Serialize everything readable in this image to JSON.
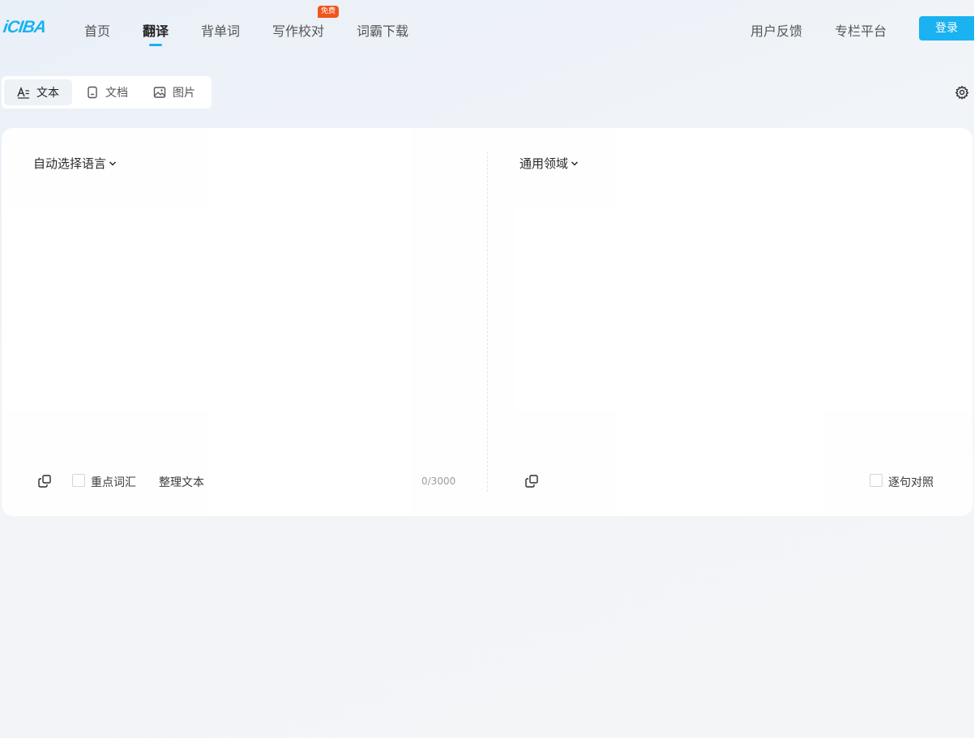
{
  "header": {
    "logo": "iCIBA",
    "nav": [
      {
        "label": "首页"
      },
      {
        "label": "翻译"
      },
      {
        "label": "背单词"
      },
      {
        "label": "写作校对",
        "badge": "免费"
      },
      {
        "label": "词霸下载"
      }
    ],
    "right_links": [
      {
        "label": "用户反馈"
      },
      {
        "label": "专栏平台"
      }
    ],
    "login_label": "登录"
  },
  "mode_tabs": [
    {
      "label": "文本",
      "icon": "text-icon"
    },
    {
      "label": "文档",
      "icon": "document-icon"
    },
    {
      "label": "图片",
      "icon": "image-icon"
    }
  ],
  "source": {
    "language": "自动选择语言",
    "text": "",
    "key_vocab_label": "重点词汇",
    "tidy_text_label": "整理文本",
    "char_count": "0/3000"
  },
  "target": {
    "domain": "通用领域",
    "sentence_compare_label": "逐句对照"
  },
  "colors": {
    "accent": "#1ab2f0",
    "badge": "#f0561d"
  }
}
